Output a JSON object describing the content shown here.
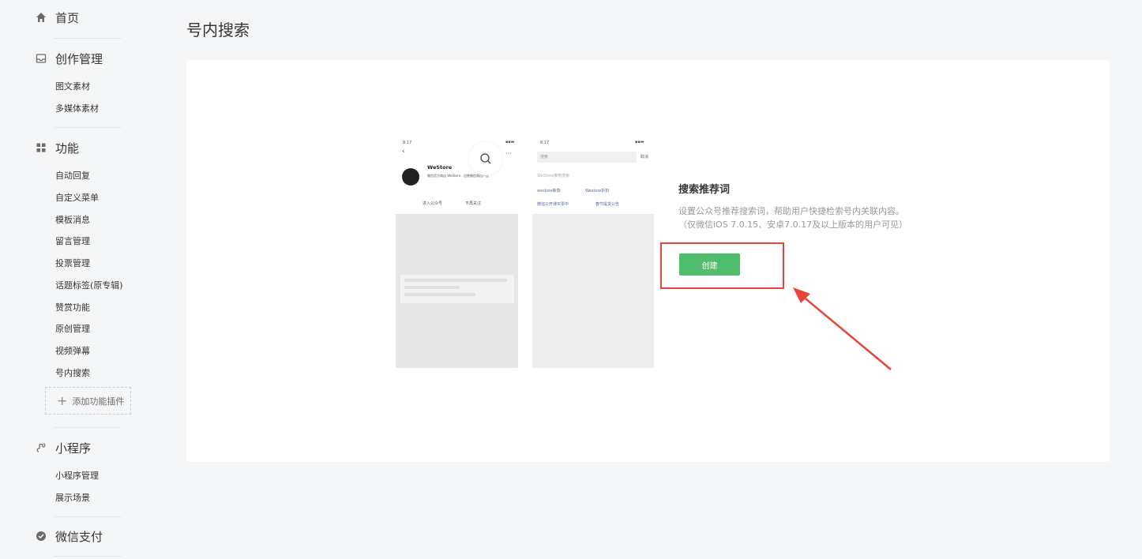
{
  "sidebar": {
    "home": {
      "label": "首页",
      "icon": "home-icon"
    },
    "creation": {
      "label": "创作管理",
      "icon": "inbox-icon",
      "items": [
        "图文素材",
        "多媒体素材"
      ]
    },
    "features": {
      "label": "功能",
      "icon": "grid-icon",
      "items": [
        "自动回复",
        "自定义菜单",
        "模板消息",
        "留言管理",
        "投票管理",
        "话题标签(原专辑)",
        "赞赏功能",
        "原创管理",
        "视频弹幕",
        "号内搜索"
      ],
      "add_plugin": "添加功能插件"
    },
    "miniprogram": {
      "label": "小程序",
      "icon": "link-icon",
      "items": [
        "小程序管理",
        "展示场景"
      ]
    },
    "wechatpay": {
      "label": "微信支付",
      "icon": "pay-icon"
    }
  },
  "page": {
    "title": "号内搜索"
  },
  "preview": {
    "phone1": {
      "time": "8:17",
      "account_name": "WeStore",
      "account_desc": "微信官方商店 WeStore，出售微信周边产品",
      "enter_btn": "进入公众号",
      "unfollow_btn": "不再关注"
    },
    "phone2": {
      "time": "8:17",
      "search_placeholder": "搜索",
      "cancel": "取消",
      "section_label": "WeStore推荐搜索",
      "tags": [
        "westore新款",
        "Westore折扣",
        "微信公开课买票中",
        "春节提货公告"
      ]
    }
  },
  "info": {
    "title": "搜索推荐词",
    "desc_line1": "设置公众号推荐搜索词，帮助用户快捷检索号内关联内容。",
    "desc_line2": "（仅微信iOS 7.0.15、安卓7.0.17及以上版本的用户可见）",
    "create_label": "创建"
  },
  "colors": {
    "accent_green": "#4fbd6b",
    "annotation_red": "#e6453a",
    "background": "#f5f6f7"
  }
}
